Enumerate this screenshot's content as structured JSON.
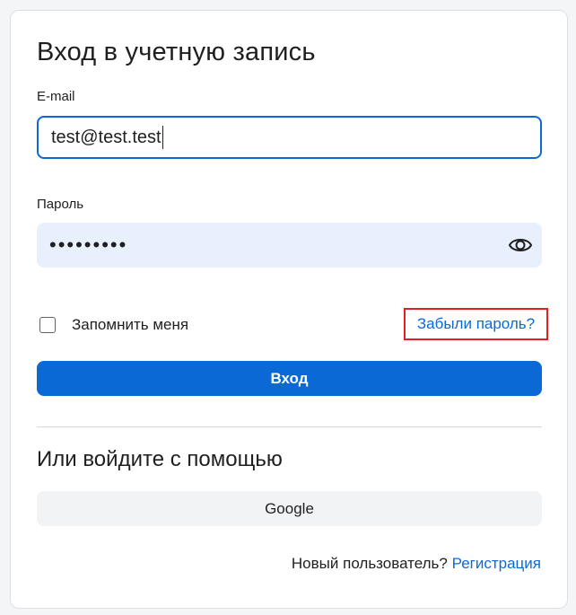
{
  "login": {
    "title": "Вход в учетную запись",
    "email_label": "E-mail",
    "email_value": "test@test.test",
    "password_label": "Пароль",
    "password_masked": "•••••••••",
    "remember_label": "Запомнить меня",
    "remember_checked": false,
    "forgot_link": "Забыли пароль?",
    "submit_label": "Вход"
  },
  "alternative": {
    "title": "Или войдите с помощью",
    "google_label": "Google"
  },
  "footer": {
    "prompt": "Новый пользователь?",
    "register_link": "Регистрация"
  },
  "colors": {
    "accent": "#0b69d6",
    "highlight_border": "#e02020",
    "password_bg": "#e8f0fe"
  },
  "icons": {
    "password_toggle": "eye-icon"
  }
}
